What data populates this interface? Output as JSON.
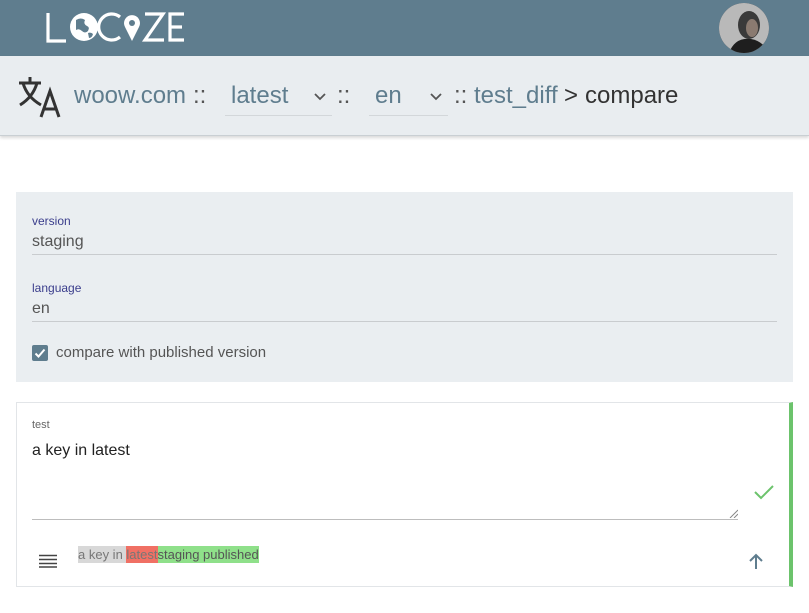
{
  "header": {
    "logo_text": "LOCIZE",
    "brand_color": "#5f7d8e"
  },
  "breadcrumb": {
    "project": "woow.com",
    "sep1": "::",
    "version_select": "latest",
    "sep2": "::",
    "language_select": "en",
    "sep3": "::",
    "namespace": "test_diff",
    "arrow": ">",
    "current": "compare"
  },
  "form": {
    "version_label": "version",
    "version_value": "staging",
    "language_label": "language",
    "language_value": "en",
    "compare_checkbox_label": "compare with published version",
    "compare_checked": true
  },
  "key_card": {
    "key_name": "test",
    "value": "a key in latest",
    "status_color": "#6cc36c",
    "diff": {
      "same": "a key in ",
      "removed": "latest",
      "added": "staging published"
    }
  },
  "icons": [
    "translate-icon",
    "chevron-down-icon",
    "avatar",
    "check-icon",
    "lines-icon",
    "arrow-up-icon"
  ]
}
